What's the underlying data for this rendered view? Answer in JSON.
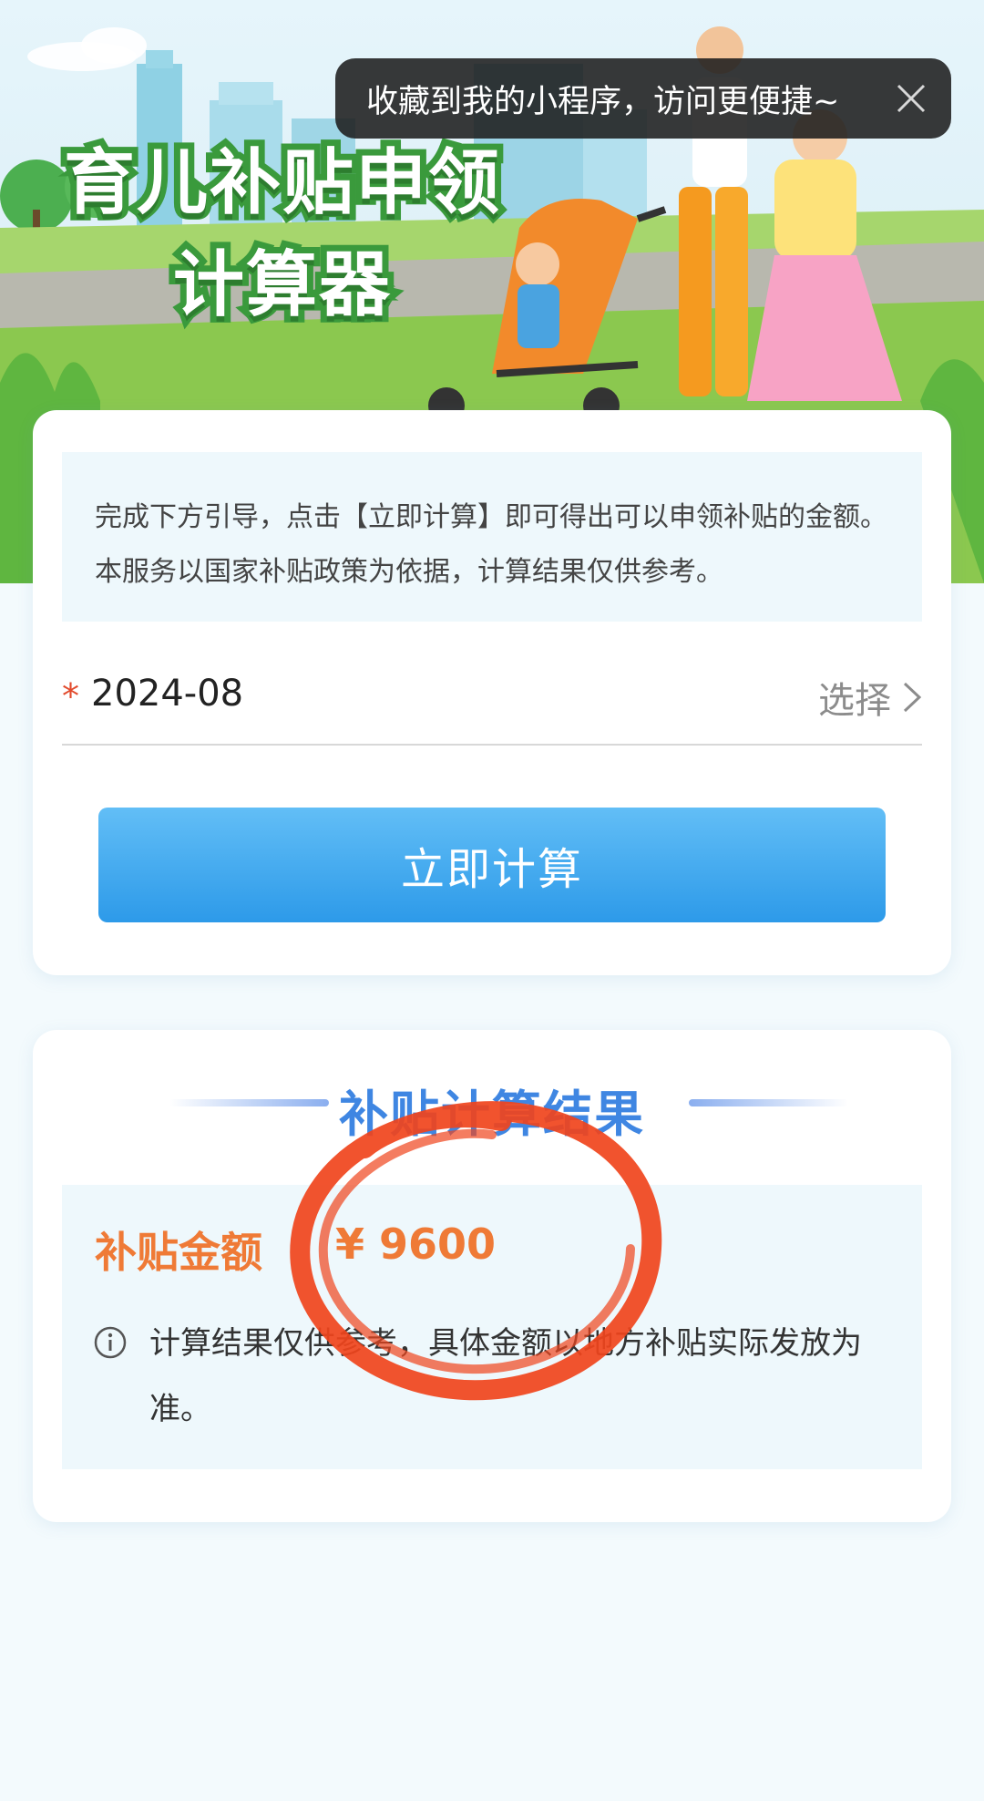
{
  "hero": {
    "title_line1": "育儿补贴申领",
    "title_line2": "计算器"
  },
  "toast": {
    "text": "收藏到我的小程序，访问更便捷~",
    "close_icon": "close-icon"
  },
  "form": {
    "notice": "完成下方引导，点击【立即计算】即可得出可以申领补贴的金额。本服务以国家补贴政策为依据，计算结果仅供参考。",
    "required_mark": "*",
    "date_value": "2024-08",
    "select_label": "选择",
    "calculate_button": "立即计算"
  },
  "result": {
    "heading": "补贴计算结果",
    "amount_label": "补贴金额",
    "amount_value": "¥ 9600",
    "disclaimer": "计算结果仅供参考，具体金额以地方补贴实际发放为准。",
    "info_icon": "info-icon"
  },
  "colors": {
    "accent_blue": "#2d9ae9",
    "heading_blue": "#3f86e2",
    "amount_orange": "#ef7a36",
    "required_red": "#e24a2c",
    "scribble_red": "#f0441c"
  }
}
